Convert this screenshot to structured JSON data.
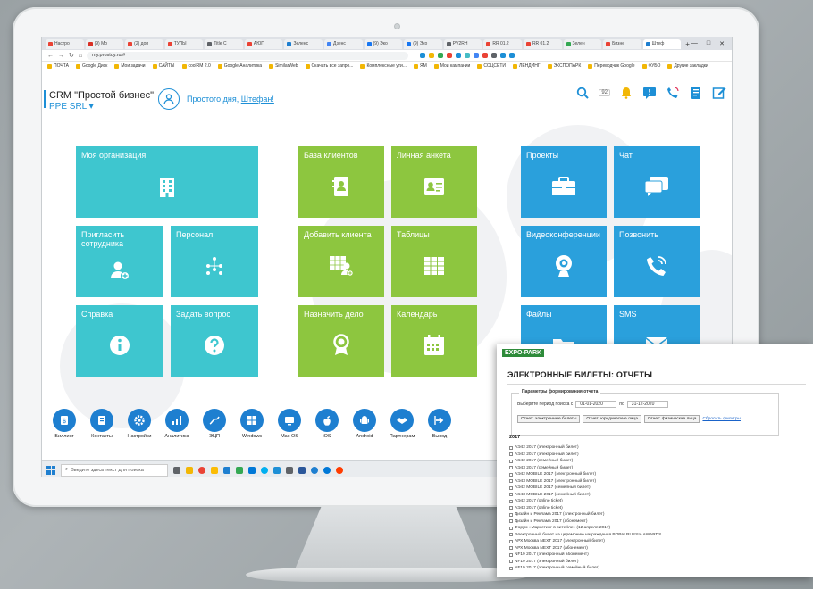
{
  "browser": {
    "tabs": [
      "Настро",
      "(9) Мо",
      "(2) доп",
      "ТУЛЫ",
      "Title C",
      "АЮП",
      "Зеленс",
      "Дзенс",
      "(9) Эко",
      "(9) Эко",
      "PV2RH",
      "RR 01.2",
      "RR 01.2",
      "Зелен",
      "Бизне",
      "Штеф"
    ],
    "url": "my.prostoy.ru/#",
    "bookmarks": [
      "ПОЧТА",
      "Google Диск",
      "Мои задачи",
      "САЙТЫ",
      "coolRM 2.0",
      "Google Аналитика",
      "SimilarWeb",
      "Скачать все запро...",
      "Комплексные ути...",
      "ЯМ",
      "Мои кампании",
      "СОЦСЕТИ",
      "ЛЕНДИНГ",
      "ЭКСПОПАРК",
      "Переводчик Google",
      "ФУБО",
      "Другие закладки"
    ]
  },
  "crm": {
    "title": "CRM \"Простой бизнес\"",
    "org": "PPE SRL ▾",
    "greeting": "Простого дня,",
    "user": "Штефан!",
    "counter": "92"
  },
  "tiles": {
    "my_org": "Моя организация",
    "invite": "Пригласить\nсотрудника",
    "staff": "Персонал",
    "help": "Справка",
    "ask": "Задать вопрос",
    "clients_db": "База клиентов",
    "profile": "Личная анкета",
    "add_client": "Добавить клиента",
    "tables": "Таблицы",
    "assign": "Назначить дело",
    "calendar": "Календарь",
    "projects": "Проекты",
    "chat": "Чат",
    "video": "Видеоконференции",
    "call": "Позвонить",
    "files": "Файлы",
    "sms": "SMS"
  },
  "dock": [
    "Биллинг",
    "Контакты",
    "Настройки",
    "Аналитика",
    "ЭЦП",
    "Windows",
    "Mac OS",
    "iOS",
    "Android",
    "Партнерам",
    "Выход"
  ],
  "taskbar": {
    "search_placeholder": "Введите здесь текст для поиска"
  },
  "report": {
    "logo": "EXPO-PARK",
    "title": "ЭЛЕКТРОННЫЕ БИЛЕТЫ: ОТЧЕТЫ",
    "legend": "Параметры формирования отчета",
    "period_label": "Выберите период поиска с",
    "date_from": "01-01-2020",
    "to_label": "по",
    "date_to": "31-12-2020",
    "btn_tickets": "Отчет: электронные билеты",
    "btn_legal": "Отчет: юридические лица",
    "btn_physical": "Отчет: физические лица",
    "reset": "Сбросить фильтры",
    "year": "2017",
    "items": [
      "АЭ42 2017 (электронный билет)",
      "АЭ42 2017 (электронный билет)",
      "АЭ42 2017 (семейный билет)",
      "АЭ43 2017 (семейный билет)",
      "АЭ42 MOBILE 2017 (электронный билет)",
      "АЭ43 MOBILE 2017 (электронный билет)",
      "АЭ42 MOBILE 2017 (семейный билет)",
      "АЭ43 MOBILE 2017 (семейный билет)",
      "АЭ42 2017 (online ticket)",
      "АЭ43 2017 (online ticket)",
      "Дизайн и Реклама 2017 (электронный билет)",
      "Дизайн и Реклама 2017 (абонемент)",
      "Форум «Маркетинг в ритейле» (12 апреля 2017)",
      "Электронный билет на церемонию награждения POPAI RUSSIA AWARDS",
      "АРХ Москва NEXT 2017 (электронный билет)",
      "АРХ Москва NEXT 2017 (абонемент)",
      "NF19 2017 (электронный абонемент)",
      "NF19 2017 (электронный билет)",
      "NF19 2017 (электронный семейный билет)"
    ]
  }
}
